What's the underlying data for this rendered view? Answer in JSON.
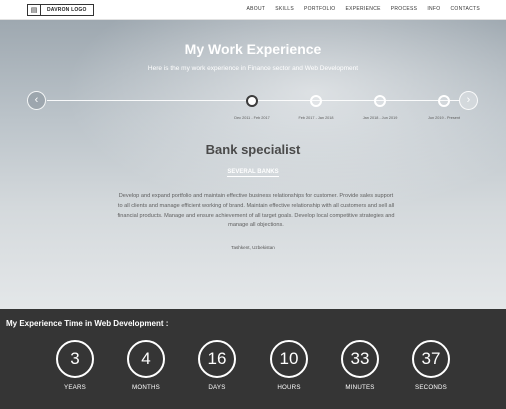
{
  "nav": {
    "logo_text": "DAVRON LOGO",
    "logo_icon": "document-icon",
    "links": [
      "ABOUT",
      "SKILLS",
      "PORTFOLIO",
      "EXPERIENCE",
      "PROCESS",
      "INFO",
      "CONTACTS"
    ]
  },
  "hero": {
    "title": "My Work Experience",
    "subtitle": "Here is the my work experience in Finance sector and Web Development",
    "timeline": {
      "prev_icon": "chevron-left-icon",
      "next_icon": "chevron-right-icon",
      "items": [
        {
          "label": "Dec 2011 - Feb 2017",
          "active": true
        },
        {
          "label": "Feb 2017 - Jan 2018",
          "active": false
        },
        {
          "label": "Jan 2018 - Jun 2019",
          "active": false
        },
        {
          "label": "Jun 2019 - Present",
          "active": false
        }
      ]
    },
    "job_title": "Bank specialist",
    "company": "SEVERAL BANKS",
    "description": "Develop and expand portfolio and maintain effective business relationships for customer. Provide sales support to all clients and manage efficient working of brand. Maintain effective relationship with all customers and sell all financial products. Manage and ensure achievement of all target goals. Develop local competitive strategies and manage all objections.",
    "location": "Tashkent, Uzbekistan"
  },
  "counter": {
    "title": "My Experience Time in Web Development :",
    "items": [
      {
        "value": "3",
        "unit": "YEARS"
      },
      {
        "value": "4",
        "unit": "MONTHS"
      },
      {
        "value": "16",
        "unit": "DAYS"
      },
      {
        "value": "10",
        "unit": "HOURS"
      },
      {
        "value": "33",
        "unit": "MINUTES"
      },
      {
        "value": "37",
        "unit": "SECONDS"
      }
    ]
  },
  "colors": {
    "counter_bg": "#353535",
    "active_dot": "#3c3c3c",
    "text_light": "#ffffff"
  }
}
